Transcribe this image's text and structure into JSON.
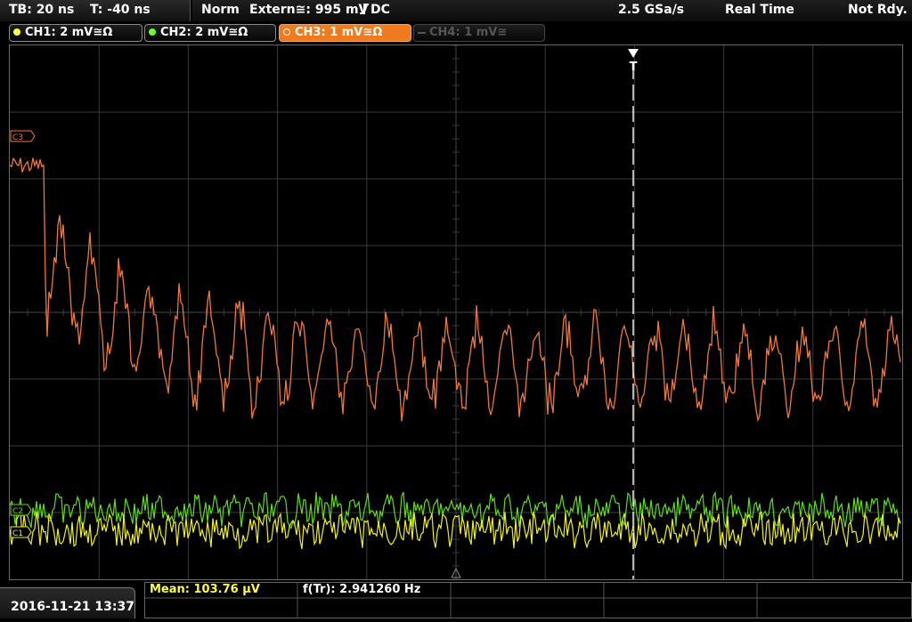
{
  "status": {
    "timebase": "TB: 20 ns",
    "trigger_offset": "T: -40 ns",
    "mode": "Norm",
    "trigger_source": "Extern≅: 995 mV",
    "trigger_coupling": "DC",
    "sample_rate": "2.5 GSa/s",
    "acq_mode": "Real Time",
    "state": "Not Rdy."
  },
  "channels": [
    {
      "label": "CH1: 2 mV≅Ω",
      "color": "#ffff3c",
      "active": false,
      "enabled": true
    },
    {
      "label": "CH2: 2 mV≅Ω",
      "color": "#66ff33",
      "active": false,
      "enabled": true
    },
    {
      "label": "CH3: 1 mV≅Ω",
      "color": "#f07a1e",
      "active": true,
      "enabled": true
    },
    {
      "label": "CH4: 1 mV≅",
      "color": "#444444",
      "active": false,
      "enabled": false
    }
  ],
  "markers": {
    "ch3": "C3",
    "ch2": "C2",
    "ch1": "C1",
    "trigger_pos": "T"
  },
  "measurements": {
    "mean": "Mean: 103.76 µV",
    "frequency": "f(Tr): 2.941260 Hz"
  },
  "timestamp": "2016-11-21 13:37",
  "colors": {
    "ch1": "#f0f020",
    "ch2": "#5fdc1e",
    "ch3": "#f0783c",
    "grid": "#3a3a3a",
    "accent_tab": "#f07a1e"
  }
}
